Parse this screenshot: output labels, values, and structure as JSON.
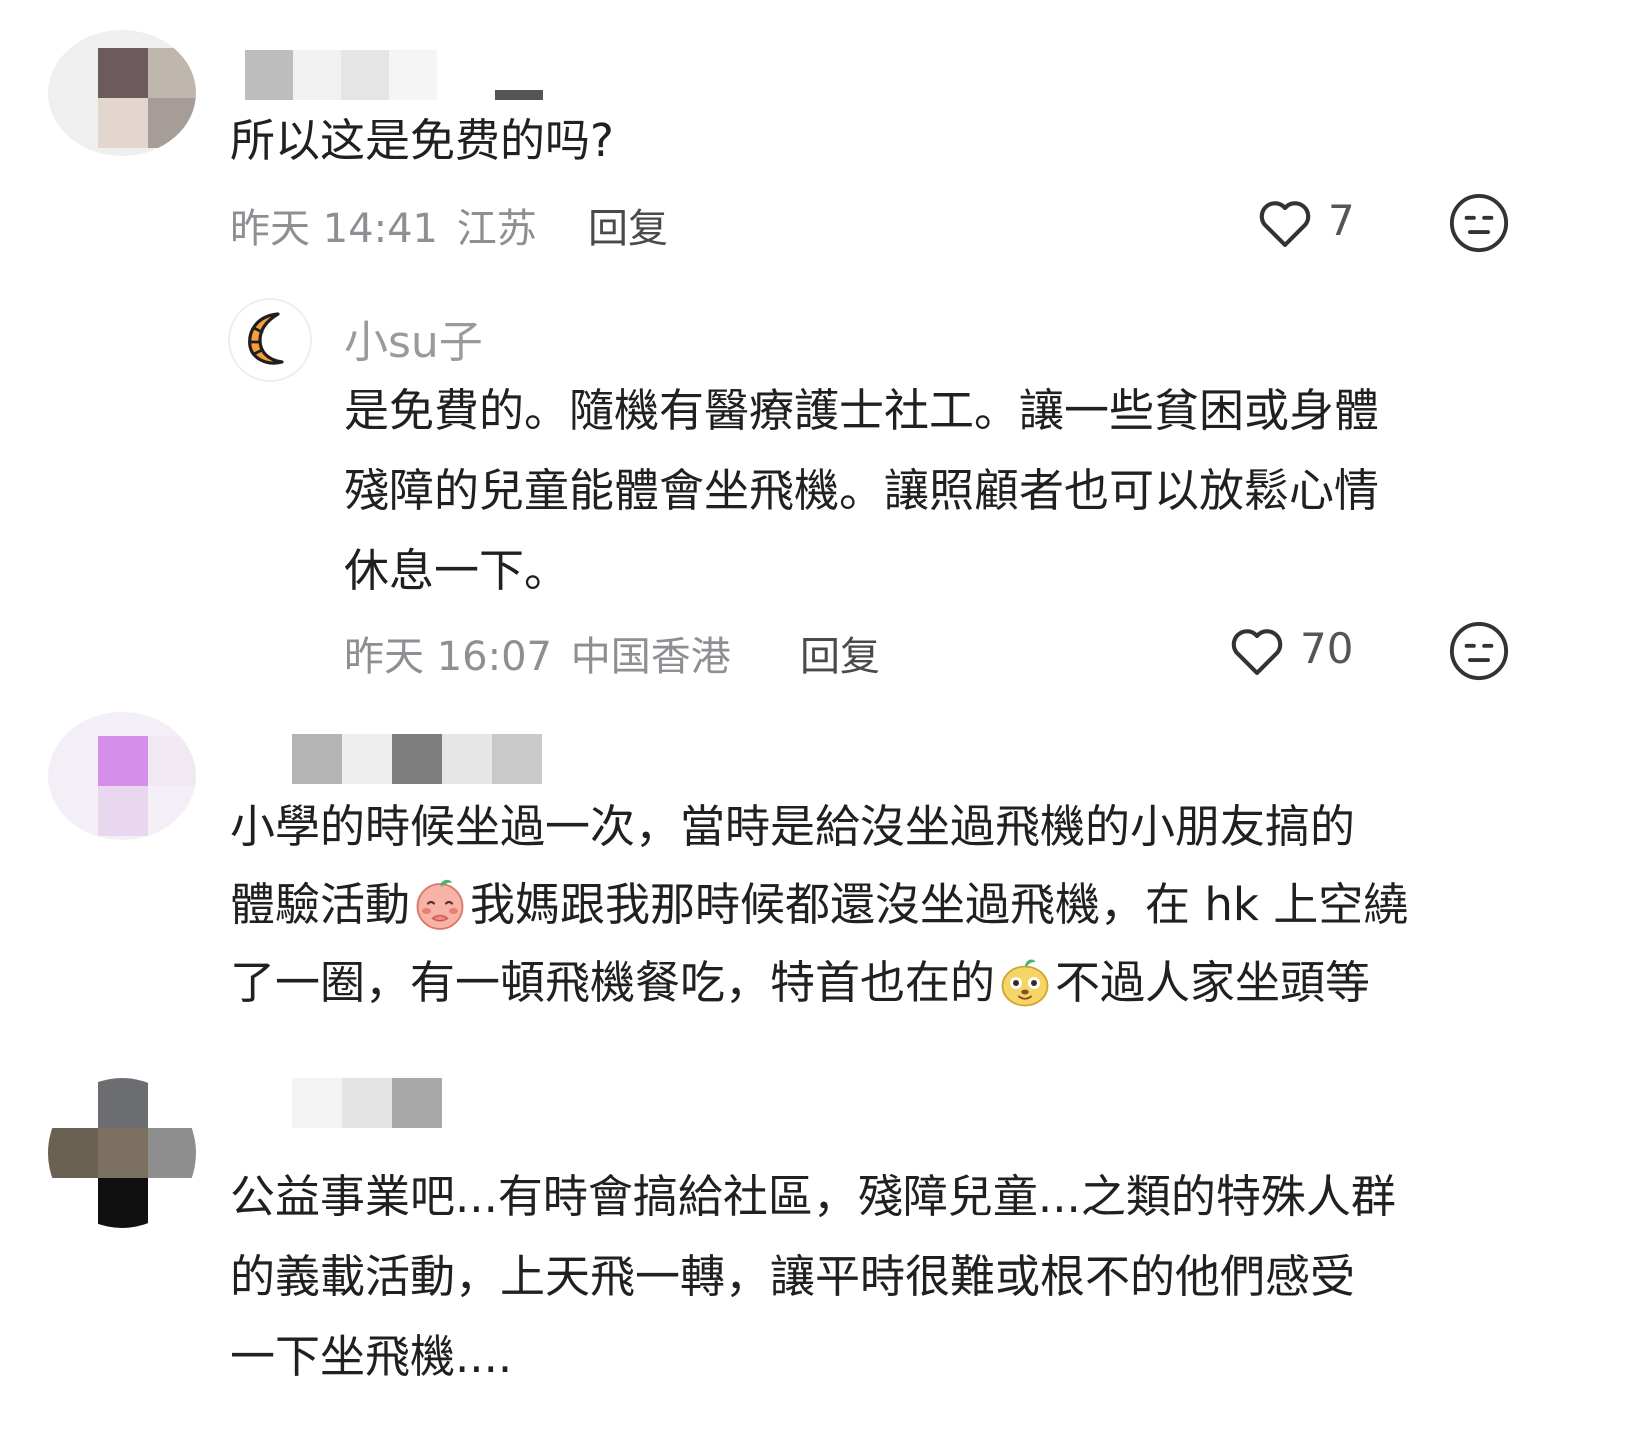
{
  "comments": [
    {
      "text": "所以这是免费的吗?",
      "time": "昨天 14:41",
      "location": "江苏",
      "reply_label": "回复",
      "likes": "7",
      "reply": {
        "username": "小su子",
        "lines": [
          "是免費的。隨機有醫療護士社工。讓一些貧困或身體",
          "殘障的兒童能體會坐飛機。讓照顧者也可以放鬆心情",
          "休息一下。"
        ],
        "time": "昨天 16:07",
        "location": "中国香港",
        "reply_label": "回复",
        "likes": "70"
      }
    },
    {
      "line1": "小學的時候坐過一次，當時是給沒坐過飛機的小朋友搞的",
      "line2_a": "體驗活動",
      "line2_b": "我媽跟我那時候都還沒坐過飛機，在 hk 上空繞",
      "line3_a": "了一圈，有一頓飛機餐吃，特首也在的",
      "line3_b": "不過人家坐頭等"
    },
    {
      "lines": [
        "公益事業吧...有時會搞給社區，殘障兒童...之類的特殊人群",
        "的義載活動，上天飛一轉，讓平時很難或根不的他們感受",
        "一下坐飛機...."
      ]
    }
  ],
  "icons": {
    "like": "heart-outline-icon",
    "dislike": "meh-face-icon",
    "croissant": "croissant-icon",
    "emoji_shy": "shy-peach-emoji",
    "emoji_smug": "smug-pear-emoji"
  },
  "colors": {
    "meta_gray": "#8e8e93",
    "text": "#202020",
    "croissant": "#f5a03a"
  }
}
